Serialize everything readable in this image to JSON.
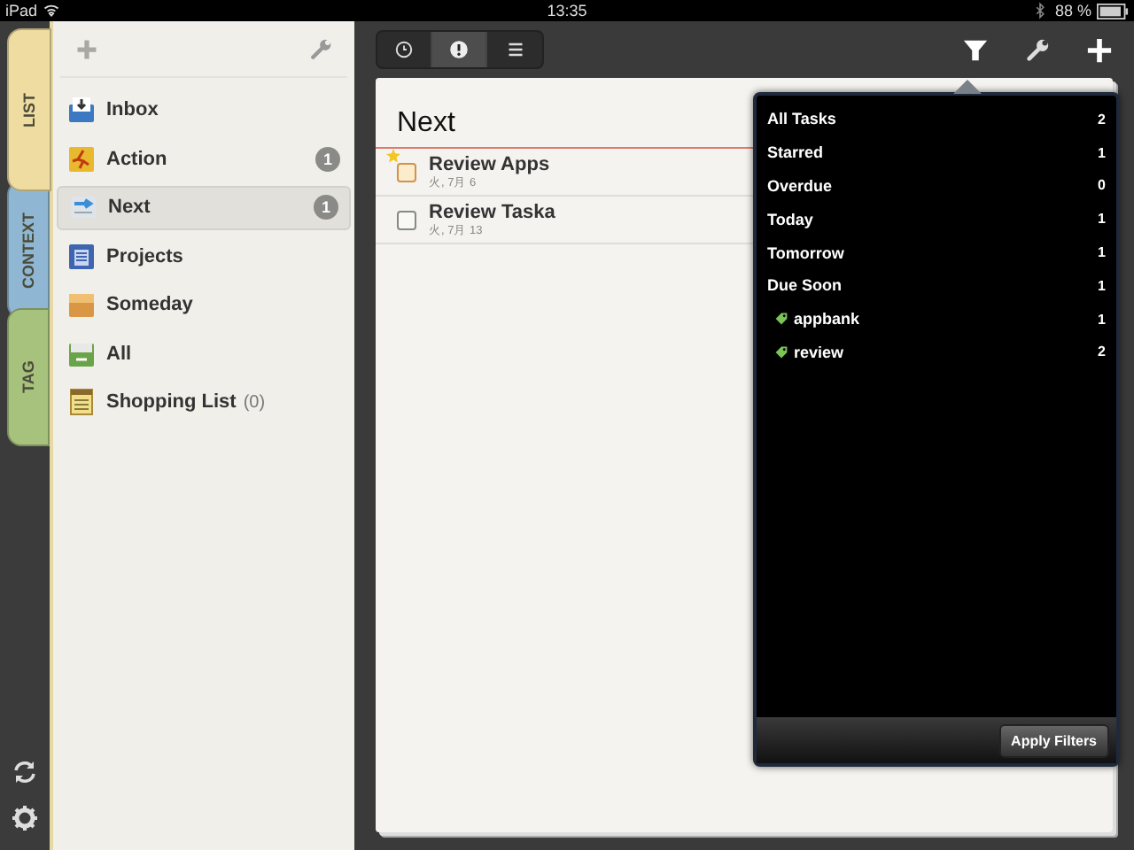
{
  "status_bar": {
    "device": "iPad",
    "time": "13:35",
    "battery": "88 %"
  },
  "side_tabs": [
    {
      "label": "LIST",
      "selected": true,
      "color": "#eedca0"
    },
    {
      "label": "CONTEXT",
      "selected": false,
      "color": "#8fb7d3"
    },
    {
      "label": "TAG",
      "selected": false,
      "color": "#a7c27d"
    }
  ],
  "sidebar": {
    "items": [
      {
        "kind": "inbox",
        "label": "Inbox",
        "selected": false
      },
      {
        "kind": "action",
        "label": "Action",
        "badge": "1",
        "selected": false
      },
      {
        "kind": "next",
        "label": "Next",
        "badge": "1",
        "selected": true
      },
      {
        "kind": "projects",
        "label": "Projects",
        "selected": false
      },
      {
        "kind": "someday",
        "label": "Someday",
        "selected": false
      },
      {
        "kind": "all",
        "label": "All",
        "selected": false
      },
      {
        "kind": "list",
        "label": "Shopping List",
        "count": "(0)",
        "selected": false
      }
    ]
  },
  "toolbar": {
    "segments": [
      {
        "kind": "clock",
        "selected": false
      },
      {
        "kind": "alert",
        "selected": true
      },
      {
        "kind": "lines",
        "selected": false
      }
    ]
  },
  "list": {
    "title": "Next",
    "tasks": [
      {
        "title": "Review Apps",
        "date": "火, 7月 6",
        "starred": true,
        "checked": false
      },
      {
        "title": "Review Taska",
        "date": "火, 7月 13",
        "starred": false,
        "checked": false
      }
    ]
  },
  "filter_popover": {
    "filters": [
      {
        "kind": "plain",
        "label": "All Tasks",
        "count": "2"
      },
      {
        "kind": "plain",
        "label": "Starred",
        "count": "1"
      },
      {
        "kind": "plain",
        "label": "Overdue",
        "count": "0"
      },
      {
        "kind": "plain",
        "label": "Today",
        "count": "1"
      },
      {
        "kind": "plain",
        "label": "Tomorrow",
        "count": "1"
      },
      {
        "kind": "plain",
        "label": "Due Soon",
        "count": "1"
      },
      {
        "kind": "tag",
        "label": "appbank",
        "count": "1"
      },
      {
        "kind": "tag",
        "label": "review",
        "count": "2"
      }
    ],
    "button": "Apply Filters"
  }
}
